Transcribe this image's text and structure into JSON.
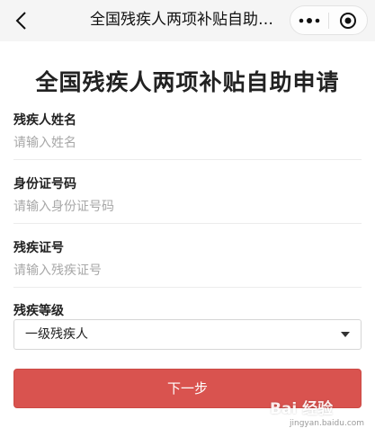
{
  "nav": {
    "title": "全国残疾人两项补贴自助…",
    "back_icon": "chevron-left-icon",
    "more_icon": "more-dots-icon",
    "close_icon": "target-close-icon"
  },
  "page": {
    "heading": "全国残疾人两项补贴自助申请"
  },
  "form": {
    "name": {
      "label": "残疾人姓名",
      "placeholder": "请输入姓名",
      "value": ""
    },
    "id_number": {
      "label": "身份证号码",
      "placeholder": "请输入身份证号码",
      "value": ""
    },
    "disability_cert": {
      "label": "残疾证号",
      "placeholder": "请输入残疾证号",
      "value": ""
    },
    "level": {
      "label": "残疾等级",
      "selected": "一级残疾人"
    }
  },
  "actions": {
    "next_label": "下一步"
  },
  "watermark": {
    "text": "Bai 经验",
    "url": "jingyan.baidu.com"
  },
  "colors": {
    "accent": "#d9534f",
    "nav_bg": "#f5f5f5",
    "placeholder": "#a8a8a8"
  }
}
